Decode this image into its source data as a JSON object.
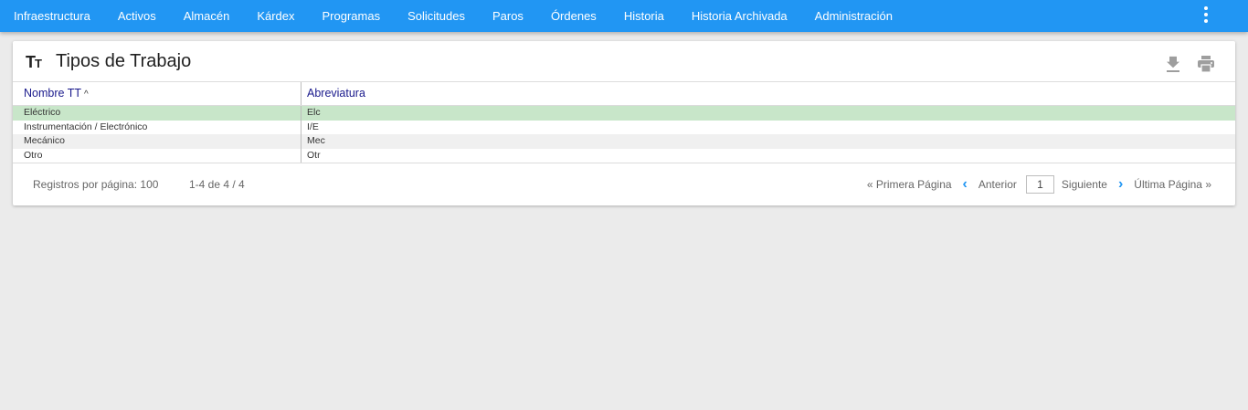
{
  "nav": {
    "items": [
      "Infraestructura",
      "Activos",
      "Almacén",
      "Kárdex",
      "Programas",
      "Solicitudes",
      "Paros",
      "Órdenes",
      "Historia",
      "Historia Archivada",
      "Administración"
    ],
    "more_icon": "more-vertical-icon"
  },
  "page": {
    "title_icon": "text-type-icon",
    "title": "Tipos de Trabajo",
    "actions": {
      "download_icon": "download-icon",
      "print_icon": "print-icon"
    }
  },
  "table": {
    "columns": [
      "Nombre TT",
      "Abreviatura"
    ],
    "sort_indicator": "^",
    "rows": [
      {
        "nombre": "Eléctrico",
        "abreviatura": "Elc",
        "selected": true
      },
      {
        "nombre": "Instrumentación / Electrónico",
        "abreviatura": "I/E"
      },
      {
        "nombre": "Mecánico",
        "abreviatura": "Mec"
      },
      {
        "nombre": "Otro",
        "abreviatura": "Otr"
      }
    ]
  },
  "footer": {
    "records_per_page": "Registros por página: 100",
    "range": "1-4 de 4 / 4",
    "first_page": "« Primera Página",
    "previous": "Anterior",
    "current_page": "1",
    "next": "Siguiente",
    "last_page": "Última Página »"
  },
  "colors": {
    "topbar": "#2196f3",
    "selected_row": "#c8e6c9",
    "header_text": "#1a1a8c",
    "background": "#ebebeb"
  }
}
